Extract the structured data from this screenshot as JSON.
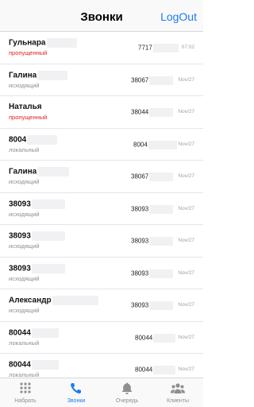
{
  "header": {
    "title": "Звонки",
    "logout_label": "LogOut"
  },
  "calls": [
    {
      "name": "Гульнара",
      "status": "пропущенный",
      "status_type": "missed",
      "number": "7717",
      "date": "07:02"
    },
    {
      "name": "Галина",
      "status": "исходящий",
      "status_type": "outgoing",
      "number": "38067",
      "date": "Nov/27"
    },
    {
      "name": "Наталья",
      "status": "пропущенный",
      "status_type": "missed",
      "number": "38044",
      "date": "Nov/27"
    },
    {
      "name": "8004",
      "status": "локальный",
      "status_type": "local",
      "number": "8004",
      "date": "Nov/27"
    },
    {
      "name": "Галина",
      "status": "исходящий",
      "status_type": "outgoing",
      "number": "38067",
      "date": "Nov/27"
    },
    {
      "name": "38093",
      "status": "исходящий",
      "status_type": "outgoing",
      "number": "38093",
      "date": "Nov/27"
    },
    {
      "name": "38093",
      "status": "исходящий",
      "status_type": "outgoing",
      "number": "38093",
      "date": "Nov/27"
    },
    {
      "name": "38093",
      "status": "исходящий",
      "status_type": "outgoing",
      "number": "38093",
      "date": "Nov/27"
    },
    {
      "name": "Александр",
      "status": "исходящий",
      "status_type": "outgoing",
      "number": "38093",
      "date": "Nov/27"
    },
    {
      "name": "80044",
      "status": "локальный",
      "status_type": "local",
      "number": "80044",
      "date": "Nov/27"
    },
    {
      "name": "80044",
      "status": "локальный",
      "status_type": "local",
      "number": "80044",
      "date": "Nov/27"
    }
  ],
  "tabs": [
    {
      "label": "Набрать",
      "icon": "dialpad-icon",
      "active": false
    },
    {
      "label": "Звонки",
      "icon": "phone-icon",
      "active": true
    },
    {
      "label": "Очередь",
      "icon": "bell-icon",
      "active": false
    },
    {
      "label": "Клиенты",
      "icon": "users-icon",
      "active": false
    }
  ],
  "colors": {
    "accent": "#1a7cf4",
    "missed": "#e02020",
    "inactive": "#8e8e93"
  }
}
